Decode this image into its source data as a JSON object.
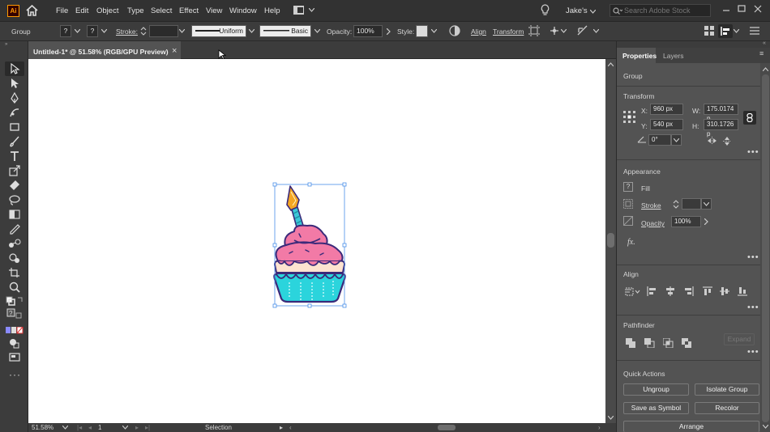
{
  "app": {
    "logo": "Ai"
  },
  "menu": [
    "File",
    "Edit",
    "Object",
    "Type",
    "Select",
    "Effect",
    "View",
    "Window",
    "Help"
  ],
  "user": {
    "name": "Jake's"
  },
  "search": {
    "placeholder": "Search Adobe Stock"
  },
  "control_bar": {
    "selection": "Group",
    "stroke_label": "Stroke:",
    "profile": "Uniform",
    "brush": "Basic",
    "opacity_label": "Opacity:",
    "opacity_value": "100%",
    "style_label": "Style:",
    "align_label": "Align",
    "transform_label": "Transform"
  },
  "document": {
    "tab_title": "Untitled-1* @ 51.58% (RGB/GPU Preview)",
    "close": "×"
  },
  "status": {
    "zoom": "51.58%",
    "artboard": "1",
    "mode": "Selection"
  },
  "properties": {
    "tabs": [
      "Properties",
      "Layers"
    ],
    "type": "Group",
    "transform": {
      "title": "Transform",
      "x_label": "X:",
      "x": "960 px",
      "y_label": "Y:",
      "y": "540 px",
      "w_label": "W:",
      "w": "175.0174 p",
      "h_label": "H:",
      "h": "310.1726 p",
      "angle": "0°"
    },
    "appearance": {
      "title": "Appearance",
      "fill": "Fill",
      "stroke": "Stroke",
      "opacity": "Opacity",
      "opacity_value": "100%",
      "fx": "fx."
    },
    "align": {
      "title": "Align"
    },
    "pathfinder": {
      "title": "Pathfinder",
      "expand": "Expand"
    },
    "quick_actions": {
      "title": "Quick Actions",
      "ungroup": "Ungroup",
      "isolate": "Isolate Group",
      "save_symbol": "Save as Symbol",
      "recolor": "Recolor",
      "arrange": "Arrange"
    }
  },
  "colors": {
    "frosting": "#f27aa6",
    "cup": "#2bd4dc",
    "outline": "#3b2a7a",
    "candle": "#3cc7d8",
    "flame": "#f5a623",
    "cream": "#fde3d0",
    "selection": "#4a8fe8",
    "ui_bg": "#535353"
  }
}
